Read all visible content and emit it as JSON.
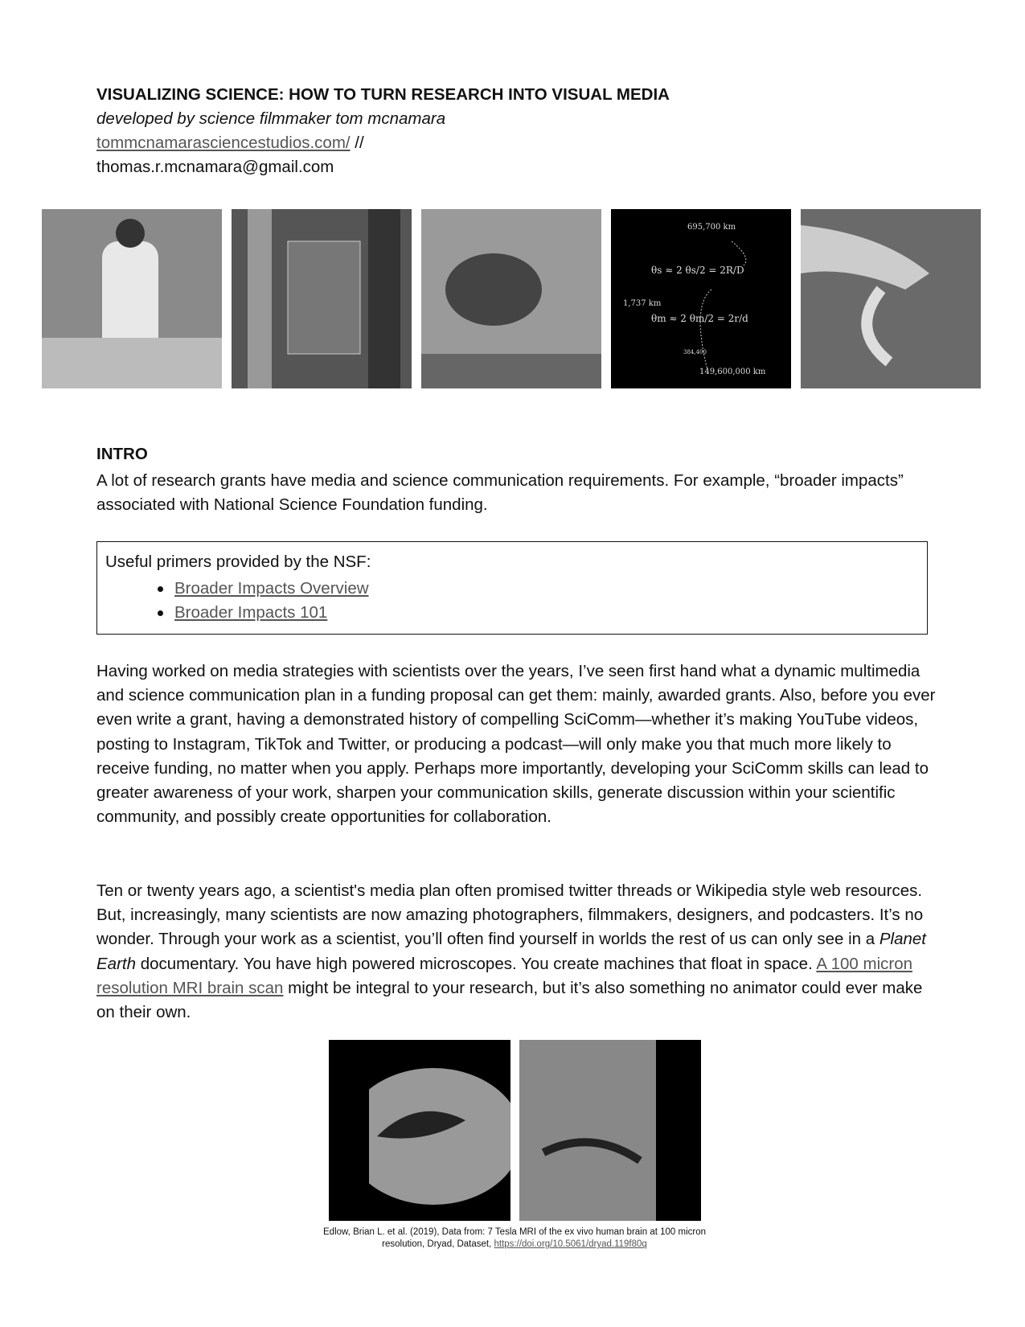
{
  "header": {
    "title": "VISUALIZING SCIENCE: HOW TO TURN RESEARCH INTO VISUAL MEDIA",
    "subtitle": "developed by science filmmaker tom mcnamara",
    "website": "tommcnamarasciencestudios.com/",
    "separator": " //",
    "email": "thomas.r.mcnamara@gmail.com"
  },
  "gallery": [
    {
      "desc": "scientist-in-lab"
    },
    {
      "desc": "lab-equipment"
    },
    {
      "desc": "underwater-seal"
    },
    {
      "desc": "sun-moon-formula",
      "labels": [
        "695,700 km",
        "θs ≈ 2 θs/2 = 2R/D",
        "1,737 km",
        "θm ≈ 2 θm/2 = 2r/d",
        "384,400",
        "149,600,000 km"
      ]
    },
    {
      "desc": "hand-with-specimen"
    }
  ],
  "intro": {
    "heading": "INTRO",
    "text": "A lot of research grants have media and science communication requirements. For example, “broader impacts” associated with National Science Foundation funding."
  },
  "primers": {
    "heading": "Useful primers provided by the NSF:",
    "links": [
      "Broader Impacts Overview",
      "Broader Impacts 101"
    ]
  },
  "p1": "Having worked on media strategies with scientists over the years, I’ve seen first hand what a dynamic multimedia and science communication plan in a funding proposal can get them: mainly, awarded grants. Also, before you ever even write a grant, having a demonstrated history of compelling SciComm—whether it’s making YouTube videos, posting to Instagram, TikTok and Twitter, or producing a podcast—will only make you that much more likely to receive funding, no matter when you apply. Perhaps more importantly, developing your SciComm skills can lead to greater awareness of your work, sharpen your communication skills, generate discussion within your scientific community, and possibly create opportunities for collaboration.",
  "p2": {
    "a": "Ten or twenty years ago, a scientist's media plan often promised twitter threads or Wikipedia style web resources. But, increasingly, many scientists are now amazing photographers, filmmakers, designers, and podcasters. It’s no wonder. Through your work as a scientist, you’ll often find yourself in worlds the rest of us can only see in a ",
    "em": "Planet Earth",
    "b": " documentary. You have high powered microscopes. You create machines that float in space. ",
    "link": "A 100 micron resolution MRI brain scan",
    "c": " might be integral to your research, but it’s also something no animator could ever make on their own."
  },
  "caption": {
    "text": "Edlow, Brian L. et al. (2019), Data from: 7 Tesla MRI of the ex vivo human brain at 100 micron resolution, Dryad, Dataset, ",
    "link": "https://doi.org/10.5061/dryad.119f80q"
  }
}
